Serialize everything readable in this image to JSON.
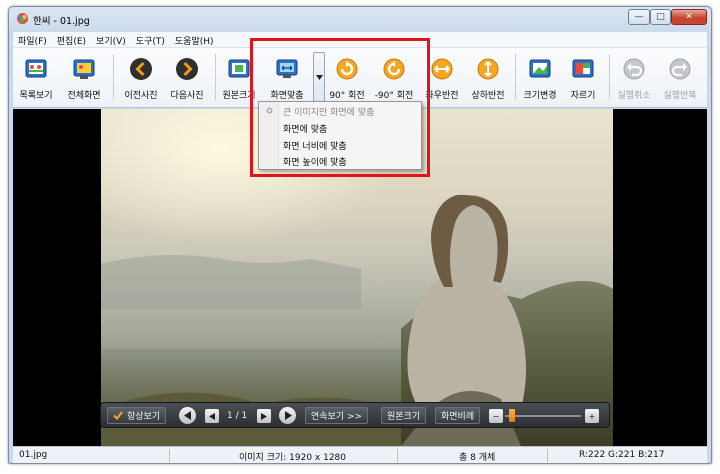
{
  "window": {
    "title": "한씨 - 01.jpg"
  },
  "caption_buttons": {
    "minimize": "—",
    "maximize": "□",
    "close": "✕"
  },
  "menu": [
    "파일(F)",
    "편집(E)",
    "보기(V)",
    "도구(T)",
    "도움말(H)"
  ],
  "toolbar": {
    "items": [
      {
        "label": "목록보기",
        "icon": "list-view-icon"
      },
      {
        "label": "전체화면",
        "icon": "fullscreen-icon"
      },
      {
        "label": "이전사진",
        "icon": "previous-icon"
      },
      {
        "label": "다음사진",
        "icon": "next-icon"
      },
      {
        "label": "원본크기",
        "icon": "original-size-icon"
      },
      {
        "label": "화면맞춤",
        "icon": "fit-screen-icon"
      },
      {
        "label": "90° 회전",
        "icon": "rotate-cw-icon"
      },
      {
        "label": "-90° 회전",
        "icon": "rotate-ccw-icon"
      },
      {
        "label": "좌우반전",
        "icon": "flip-horizontal-icon"
      },
      {
        "label": "상하반전",
        "icon": "flip-vertical-icon"
      },
      {
        "label": "크기변경",
        "icon": "resize-icon"
      },
      {
        "label": "자르기",
        "icon": "crop-icon"
      },
      {
        "label": "실행취소",
        "icon": "undo-icon"
      },
      {
        "label": "실행반복",
        "icon": "redo-icon"
      }
    ]
  },
  "dropdown": {
    "items": [
      {
        "label": "큰 이미지만 화면에 맞춤",
        "selected": true
      },
      {
        "label": "화면에 맞춤",
        "selected": false
      },
      {
        "label": "화면 너비에 맞춤",
        "selected": false
      },
      {
        "label": "화면 높이에 맞춤",
        "selected": false
      }
    ]
  },
  "controls": {
    "always_on_top": "항상보기",
    "page": "1 / 1",
    "slideshow": "연속보기 >>",
    "original_size": "원본크기",
    "fit_ratio": "화면비례",
    "zoom_minus": "−",
    "zoom_plus": "+"
  },
  "status": {
    "filename": "01.jpg",
    "image_size": "이미지 크기: 1920 x 1280",
    "count": "총 8 개체",
    "rgb": "R:222 G:221 B:217"
  },
  "colors": {
    "highlight": "#e0151b",
    "accent_orange": "#f08a00"
  }
}
